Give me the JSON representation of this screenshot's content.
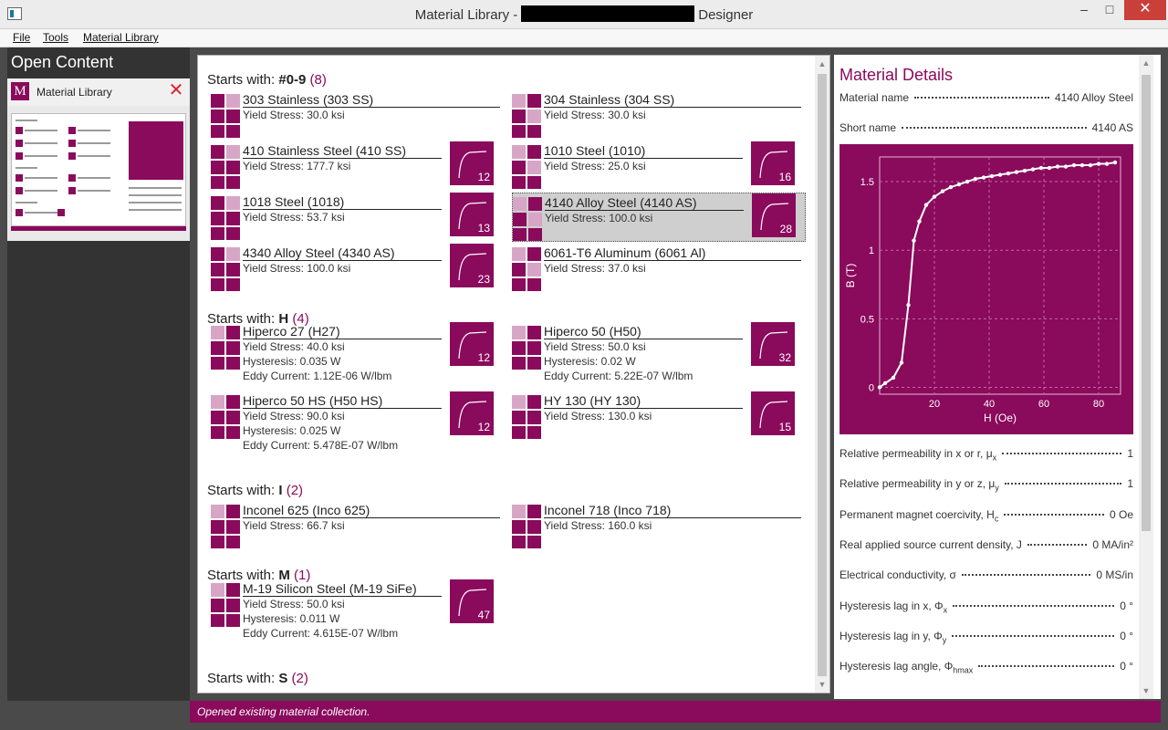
{
  "window": {
    "title_left": "Material Library -",
    "title_right": "Designer",
    "min_glyph": "–",
    "max_glyph": "□",
    "close_glyph": "✕"
  },
  "menu": {
    "items": [
      "File",
      "Tools",
      "Material Library"
    ]
  },
  "sidebar": {
    "title": "Open Content",
    "open_item": {
      "badge": "M",
      "label": "Material Library",
      "close_glyph": "✕"
    }
  },
  "list": {
    "sections": [
      {
        "prefix": "Starts with: ",
        "key": "#0-9",
        "count": "(8)"
      },
      {
        "prefix": "Starts with: ",
        "key": "H",
        "count": "(4)"
      },
      {
        "prefix": "Starts with: ",
        "key": "I",
        "count": "(2)"
      },
      {
        "prefix": "Starts with: ",
        "key": "M",
        "count": "(1)"
      },
      {
        "prefix": "Starts with: ",
        "key": "S",
        "count": "(2)"
      }
    ],
    "cards": [
      {
        "name": "303 Stainless (303 SS)",
        "lines": [
          "Yield Stress: 30.0 ksi"
        ],
        "curve": null,
        "selected": false
      },
      {
        "name": "304 Stainless (304 SS)",
        "lines": [
          "Yield Stress: 30.0 ksi"
        ],
        "curve": null,
        "selected": false
      },
      {
        "name": "410 Stainless Steel (410 SS)",
        "lines": [
          "Yield Stress: 177.7 ksi"
        ],
        "curve": "12",
        "selected": false
      },
      {
        "name": "1010 Steel (1010)",
        "lines": [
          "Yield Stress: 25.0 ksi"
        ],
        "curve": "16",
        "selected": false
      },
      {
        "name": "1018 Steel (1018)",
        "lines": [
          "Yield Stress: 53.7 ksi"
        ],
        "curve": "13",
        "selected": false
      },
      {
        "name": "4140 Alloy Steel (4140 AS)",
        "lines": [
          "Yield Stress: 100.0 ksi"
        ],
        "curve": "28",
        "selected": true
      },
      {
        "name": "4340 Alloy Steel (4340 AS)",
        "lines": [
          "Yield Stress: 100.0 ksi"
        ],
        "curve": "23",
        "selected": false
      },
      {
        "name": "6061-T6 Aluminum (6061 Al)",
        "lines": [
          "Yield Stress: 37.0 ksi"
        ],
        "curve": null,
        "selected": false
      },
      {
        "name": "Hiperco 27 (H27)",
        "lines": [
          "Yield Stress: 40.0 ksi",
          "Hysteresis: 0.035 W",
          "Eddy Current: 1.12E-06 W/lbm"
        ],
        "curve": "12",
        "selected": false
      },
      {
        "name": "Hiperco 50 (H50)",
        "lines": [
          "Yield Stress: 50.0 ksi",
          "Hysteresis: 0.02 W",
          "Eddy Current: 5.22E-07 W/lbm"
        ],
        "curve": "32",
        "selected": false
      },
      {
        "name": "Hiperco 50 HS (H50 HS)",
        "lines": [
          "Yield Stress: 90.0 ksi",
          "Hysteresis: 0.025 W",
          "Eddy Current: 5.478E-07 W/lbm"
        ],
        "curve": "12",
        "selected": false
      },
      {
        "name": "HY 130 (HY 130)",
        "lines": [
          "Yield Stress: 130.0 ksi"
        ],
        "curve": "15",
        "selected": false
      },
      {
        "name": "Inconel 625 (Inco 625)",
        "lines": [
          "Yield Stress: 66.7 ksi"
        ],
        "curve": null,
        "selected": false
      },
      {
        "name": "Inconel 718 (Inco 718)",
        "lines": [
          "Yield Stress: 160.0 ksi"
        ],
        "curve": null,
        "selected": false
      },
      {
        "name": "M-19 Silicon Steel (M-19 SiFe)",
        "lines": [
          "Yield Stress: 50.0 ksi",
          "Hysteresis: 0.011 W",
          "Eddy Current: 4.615E-07 W/lbm"
        ],
        "curve": "47",
        "selected": false
      }
    ]
  },
  "details": {
    "title": "Material Details",
    "rows_top": [
      {
        "label": "Material name",
        "value": "4140 Alloy Steel"
      },
      {
        "label": "Short name",
        "value": "4140 AS"
      }
    ],
    "rows_bottom": [
      {
        "label": "Relative permeability in x or r,  μ",
        "sub": "x",
        "value": "1"
      },
      {
        "label": "Relative permeability in y or z,  μ",
        "sub": "y",
        "value": "1"
      },
      {
        "label": "Permanent magnet coercivity, H",
        "sub": "c",
        "value": "0 Oe"
      },
      {
        "label": "Real applied source current density, J",
        "sub": "",
        "value": "0 MA/in²"
      },
      {
        "label": "Electrical conductivity, σ",
        "sub": "",
        "value": "0 MS/in"
      },
      {
        "label": "Hysteresis lag in x, Φ",
        "sub": "x",
        "value": "0 °"
      },
      {
        "label": "Hysteresis lag in y, Φ",
        "sub": "y",
        "value": "0 °"
      },
      {
        "label": "Hysteresis lag angle, Φ",
        "sub": "hmax",
        "value": "0 °"
      }
    ]
  },
  "chart_data": {
    "type": "scatter",
    "title": "",
    "xlabel": "H (Oe)",
    "ylabel": "B (T)",
    "xlim": [
      0,
      88
    ],
    "ylim": [
      -0.05,
      1.68
    ],
    "xticks": [
      20,
      40,
      60,
      80
    ],
    "yticks": [
      0,
      0.5,
      1,
      1.5
    ],
    "ytick_labels": [
      "0",
      "0.5",
      "1",
      "1.5"
    ],
    "grid": true,
    "series": [
      {
        "x": [
          0,
          2,
          5,
          8,
          10.5,
          12.5,
          14.5,
          17,
          20,
          23,
          26,
          29,
          32,
          35,
          38,
          41,
          44,
          47,
          50,
          53,
          56,
          59,
          62,
          65,
          68,
          71,
          74,
          77,
          80,
          83,
          86
        ],
        "y": [
          0,
          0.03,
          0.07,
          0.18,
          0.6,
          1.07,
          1.21,
          1.33,
          1.39,
          1.43,
          1.46,
          1.48,
          1.5,
          1.52,
          1.53,
          1.54,
          1.55,
          1.56,
          1.57,
          1.58,
          1.59,
          1.6,
          1.6,
          1.61,
          1.61,
          1.62,
          1.62,
          1.62,
          1.63,
          1.63,
          1.64
        ]
      }
    ],
    "colors": {
      "background": "#8a0a5c",
      "line": "#ffffff",
      "grid": "#c06aa0"
    }
  },
  "status": {
    "text": "Opened existing material collection."
  },
  "colors": {
    "accent": "#8a0a5c",
    "accent_light": "#d7a6c6"
  }
}
